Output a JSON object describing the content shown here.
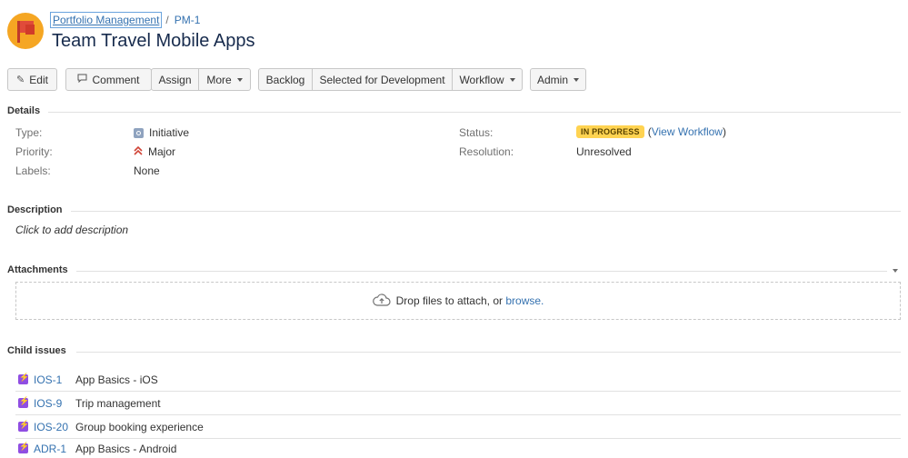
{
  "breadcrumb": {
    "project": "Portfolio Management",
    "separator": "/",
    "issue_key": "PM-1"
  },
  "issue": {
    "title": "Team Travel Mobile Apps"
  },
  "toolbar": {
    "edit": "Edit",
    "comment": "Comment",
    "assign": "Assign",
    "more": "More",
    "backlog": "Backlog",
    "selected_for_development": "Selected for Development",
    "workflow": "Workflow",
    "admin": "Admin"
  },
  "details": {
    "heading": "Details",
    "type_label": "Type:",
    "type_value": "Initiative",
    "priority_label": "Priority:",
    "priority_value": "Major",
    "labels_label": "Labels:",
    "labels_value": "None",
    "status_label": "Status:",
    "status_value": "IN PROGRESS",
    "view_workflow_open": "(",
    "view_workflow_link": "View Workflow",
    "view_workflow_close": ")",
    "resolution_label": "Resolution:",
    "resolution_value": "Unresolved"
  },
  "description": {
    "heading": "Description",
    "placeholder": "Click to add description"
  },
  "attachments": {
    "heading": "Attachments",
    "drop_text": "Drop files to attach, or ",
    "browse_link": "browse."
  },
  "child_issues": {
    "heading": "Child issues",
    "items": [
      {
        "key": "IOS-1",
        "summary": "App Basics - iOS"
      },
      {
        "key": "IOS-9",
        "summary": "Trip management"
      },
      {
        "key": "IOS-20",
        "summary": "Group booking experience"
      },
      {
        "key": "ADR-1",
        "summary": "App Basics - Android"
      }
    ]
  },
  "colors": {
    "status_lozenge": "#ffd351",
    "link": "#3572b0",
    "avatar_bg": "#f5a623",
    "epic_icon": "#904ee2"
  }
}
